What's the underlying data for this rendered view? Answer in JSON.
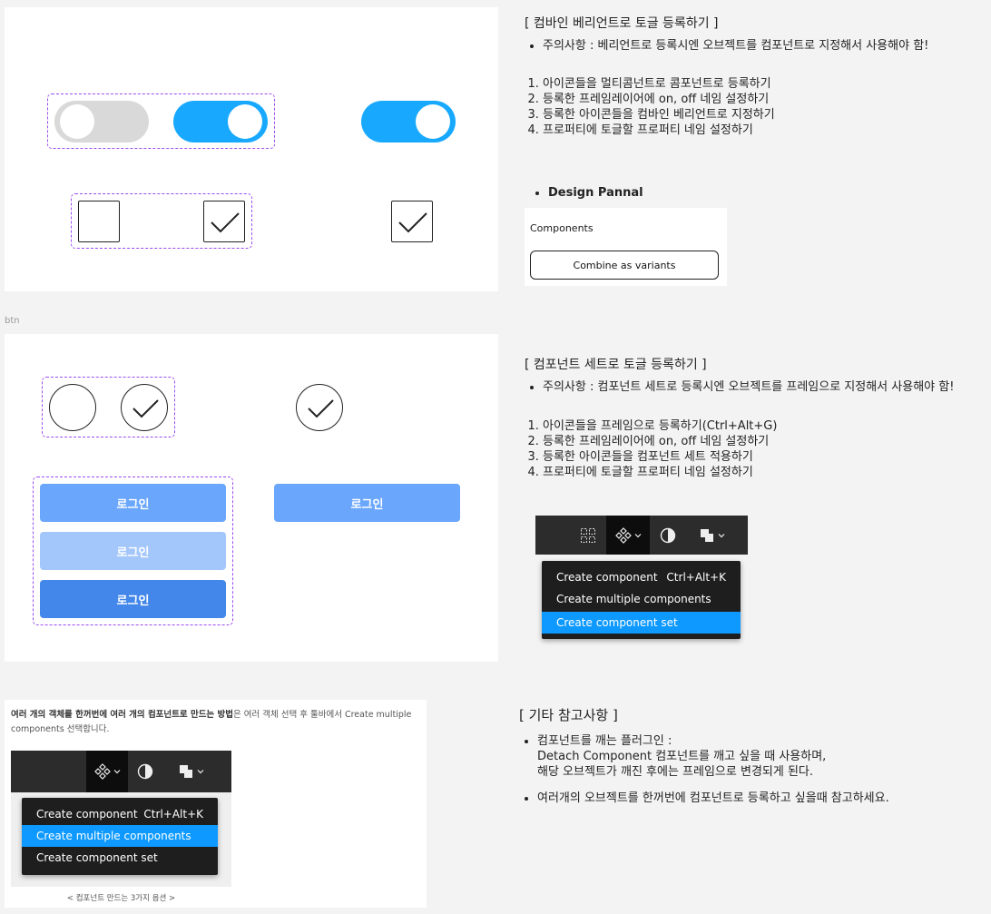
{
  "section1": {
    "title": "[ 컴바인 베리언트로 토글 등록하기 ]",
    "note": "주의사항 :  베리언트로 등록시엔 오브젝트를 컴포넌트로 지정해서 사용해야 함!",
    "steps": [
      "아이콘들을 멀티콤넌트로 콤포넌트로 등록하기",
      "등록한 프레임레이어에 on, off 네임 설정하기",
      "등록한 아이콘들을 컴바인 베리언트로 지정하기",
      "프로퍼티에 토글할 프로퍼티 네임 설정하기"
    ],
    "design_panel_label": "Design Pannal",
    "components_label": "Components",
    "combine_button": "Combine as variants"
  },
  "frame_label": "btn",
  "section2": {
    "title": "[ 컴포넌트 세트로 토글 등록하기 ]",
    "note": "주의사항 :  컴포넌트 세트로 등록시엔 오브젝트를 프레임으로 지정해서 사용해야 함!",
    "steps": [
      "아이콘들을 프레임으로 등록하기(Ctrl+Alt+G)",
      "등록한 프레임레이어에 on, off 네임 설정하기",
      "등록한 아이콘들을 컴포넌트 세트 적용하기",
      "프로퍼티에 토글할 프로퍼티 네임 설정하기"
    ],
    "login_label": "로그인",
    "menu": {
      "item1": "Create component",
      "item1_shortcut": "Ctrl+Alt+K",
      "item2": "Create multiple components",
      "item3": "Create component set"
    }
  },
  "section3": {
    "caption_bold": "여러 개의 객체를 한꺼번에 여러 개의 컴포넌트로 만드는 방법",
    "caption_rest": "은 여러 객체 선택 후 툴바에서 Create multiple components 선택합니다.",
    "image_caption": "< 컴포넌트 만드는 3가지 옵션 >",
    "menu": {
      "item1": "Create component",
      "item1_shortcut": "Ctrl+Alt+K",
      "item2": "Create multiple components",
      "item3": "Create component set"
    },
    "title": "[ 기타 참고사항 ]",
    "bullet1_line1": "컴포넌트를 깨는 플러그인 :",
    "bullet1_line2": "Detach Component 컴포넌트를 깨고 싶을 때 사용하며,",
    "bullet1_line3": "해당 오브젝트가 깨진 후에는 프레임으로 변경되게 된다.",
    "bullet2": "여러개의 오브젝트를 한꺼번에 컴포넌트로 등록하고 싶을때 참고하세요."
  },
  "colors": {
    "toggle_on": "#18a9ff",
    "toggle_off": "#d9d9d9",
    "variant_border": "#9b4cf0",
    "login_default": "#6aa6fb",
    "login_disabled": "#a3c6fb",
    "login_pressed": "#4387ea",
    "menu_highlight": "#0d99ff"
  },
  "icons": [
    "check-icon",
    "component-icon",
    "grid-icon",
    "contrast-icon",
    "layers-icon",
    "chevron-down-icon"
  ]
}
